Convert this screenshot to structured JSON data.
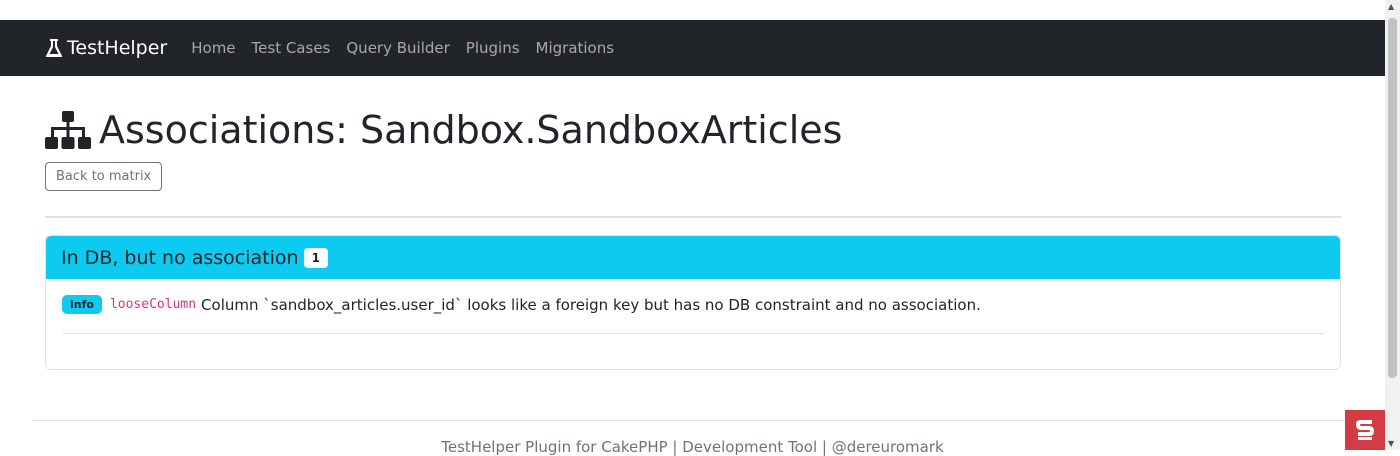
{
  "navbar": {
    "brand": "TestHelper",
    "links": [
      "Home",
      "Test Cases",
      "Query Builder",
      "Plugins",
      "Migrations"
    ]
  },
  "page": {
    "title": "Associations: Sandbox.SandboxArticles",
    "back_button": "Back to matrix"
  },
  "card": {
    "header": "In DB, but no association",
    "count": "1",
    "issues": [
      {
        "level": "info",
        "code": "looseColumn",
        "message": "Column `sandbox_articles.user_id` looks like a foreign key but has no DB constraint and no association."
      }
    ]
  },
  "footer": {
    "text": "TestHelper Plugin for CakePHP | Development Tool | @dereuromark"
  },
  "colors": {
    "navbar": "#212529",
    "card_header": "#0dcaf0",
    "code": "#d63384",
    "debug_kit": "#d33c43"
  }
}
